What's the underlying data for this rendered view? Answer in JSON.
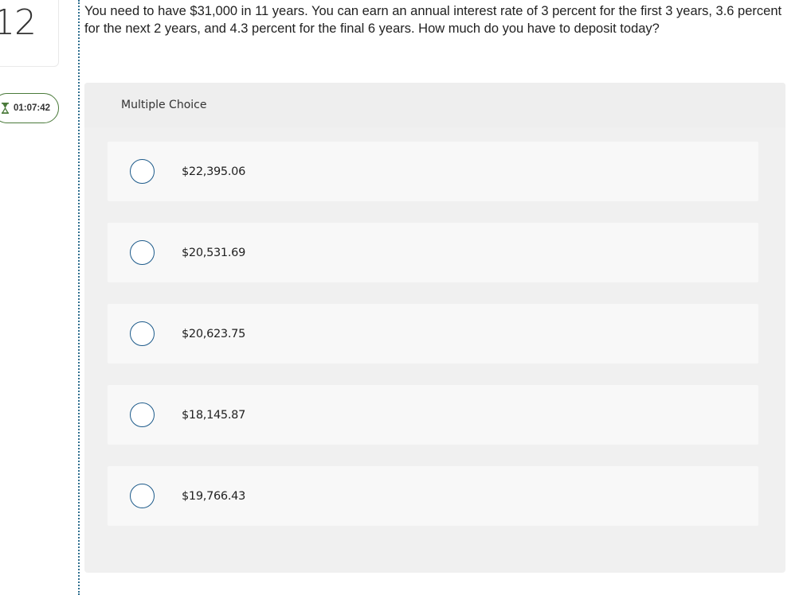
{
  "question_number": "12",
  "timer": {
    "icon": "hourglass-icon",
    "value": "01:07:42",
    "color": "#4a7a3a"
  },
  "question": {
    "text": "You need to have $31,000 in 11 years. You can earn an annual interest rate of 3 percent for the first 3 years, 3.6 percent for the next 2 years, and 4.3 percent for the final 6 years. How much do you have to deposit today?"
  },
  "answer_panel": {
    "header": "Multiple Choice",
    "choices": [
      {
        "label": "$22,395.06",
        "selected": false
      },
      {
        "label": "$20,531.69",
        "selected": false
      },
      {
        "label": "$20,623.75",
        "selected": false
      },
      {
        "label": "$18,145.87",
        "selected": false
      },
      {
        "label": "$19,766.43",
        "selected": false
      }
    ]
  },
  "colors": {
    "accent": "#1c5a8a",
    "divider": "#2f6f8f",
    "panel_bg": "#f0f0f0",
    "choice_bg": "#f8f8f8"
  }
}
